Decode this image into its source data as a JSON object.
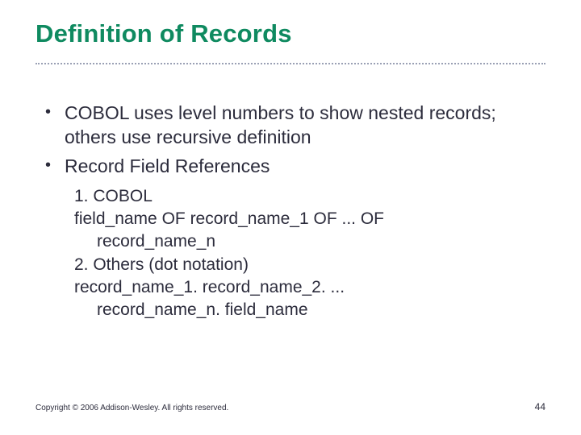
{
  "title": "Definition of Records",
  "bullets": [
    "COBOL uses level numbers to show nested records; others use recursive definition",
    "Record Field References"
  ],
  "sub": {
    "line1": "1. COBOL",
    "line2": "field_name OF record_name_1 OF ... OF",
    "line2_indent": "record_name_n",
    "line3": "2. Others (dot notation)",
    "line4": "record_name_1. record_name_2. ...",
    "line4_indent": "record_name_n. field_name"
  },
  "footer": {
    "copyright": "Copyright © 2006 Addison-Wesley. All rights reserved.",
    "page": "44"
  }
}
